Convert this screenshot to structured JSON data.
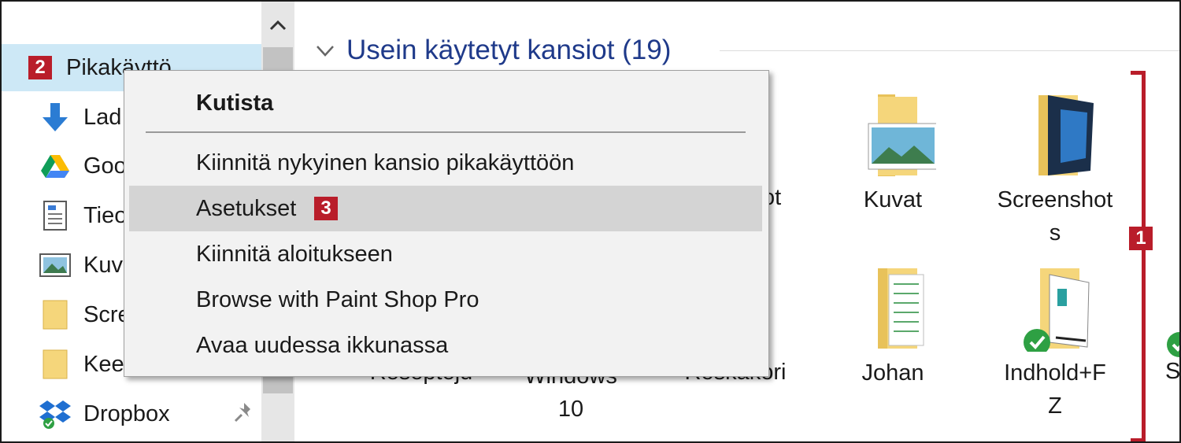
{
  "sidebar": {
    "items": [
      {
        "label": "Pikakäyttö",
        "icon": "quick-access-star-icon"
      },
      {
        "label": "Lad",
        "icon": "download-arrow-icon"
      },
      {
        "label": "Goo",
        "icon": "google-drive-icon"
      },
      {
        "label": "Tieo",
        "icon": "document-icon"
      },
      {
        "label": "Kuv",
        "icon": "pictures-icon"
      },
      {
        "label": "Scre",
        "icon": "folder-icon"
      },
      {
        "label": "Kee",
        "icon": "folder-icon"
      },
      {
        "label": "Dropbox",
        "icon": "dropbox-icon"
      }
    ]
  },
  "main": {
    "section_title": "Usein käytetyt kansiot (19)",
    "folders": [
      {
        "label": "Kuvat",
        "icon": "pictures-folder-icon"
      },
      {
        "label": "Screenshot\ns",
        "icon": "screenshots-folder-icon"
      },
      {
        "label": "Johan",
        "icon": "documents-folder-icon"
      },
      {
        "label": "Indhold+F\nZ",
        "icon": "synced-folder-icon"
      }
    ],
    "partial_labels": {
      "behind_menu_1": "Resepteju",
      "behind_menu_2": "Windows\n10",
      "behind_menu_3": "Roskakori",
      "behind_menu_4": "ot",
      "right_edge": "S"
    }
  },
  "context_menu": {
    "items": [
      {
        "label": "Kutista",
        "bold": true
      },
      {
        "label": "Kiinnitä nykyinen kansio pikakäyttöön"
      },
      {
        "label": "Asetukset",
        "hover": true
      },
      {
        "label": "Kiinnitä aloitukseen"
      },
      {
        "label": "Browse with Paint Shop Pro"
      },
      {
        "label": "Avaa uudessa ikkunassa"
      }
    ]
  },
  "callouts": {
    "badge1": "1",
    "badge2": "2",
    "badge3": "3"
  },
  "colors": {
    "accent_red": "#b91d2a",
    "selection_blue": "#cde8f6",
    "header_blue": "#1f3a8a",
    "folder_yellow": "#f5d67b",
    "sync_green": "#2ea043"
  }
}
